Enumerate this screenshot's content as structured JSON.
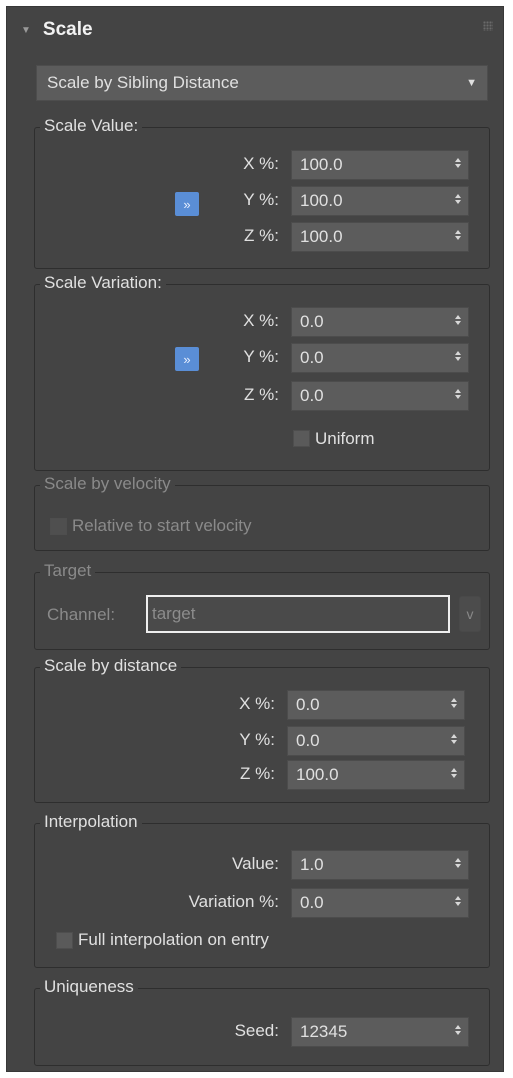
{
  "rollout": {
    "title": "Scale",
    "collapse_icon": "triangle-down-icon",
    "grip_icon": "drag-grip-icon"
  },
  "mode_dropdown": {
    "selected": "Scale by Sibling Distance"
  },
  "scale_value": {
    "title": "Scale Value:",
    "x_label": "X %:",
    "x_value": "100.0",
    "y_label": "Y %:",
    "y_value": "100.0",
    "z_label": "Z %:",
    "z_value": "100.0",
    "link_glyph": "»"
  },
  "scale_variation": {
    "title": "Scale Variation:",
    "x_label": "X %:",
    "x_value": "0.0",
    "y_label": "Y %:",
    "y_value": "0.0",
    "z_label": "Z %:",
    "z_value": "0.0",
    "link_glyph": "»",
    "uniform_label": "Uniform"
  },
  "scale_by_velocity": {
    "title": "Scale by velocity",
    "relative_label": "Relative to start velocity"
  },
  "target": {
    "title": "Target",
    "channel_label": "Channel:",
    "channel_value": "target",
    "channel_button": "v"
  },
  "scale_by_distance": {
    "title": "Scale by distance",
    "x_label": "X %:",
    "x_value": "0.0",
    "y_label": "Y %:",
    "y_value": "0.0",
    "z_label": "Z %:",
    "z_value": "100.0"
  },
  "interpolation": {
    "title": "Interpolation",
    "value_label": "Value:",
    "value": "1.0",
    "variation_label": "Variation %:",
    "variation": "0.0",
    "full_label": "Full interpolation on entry"
  },
  "uniqueness": {
    "title": "Uniqueness",
    "seed_label": "Seed:",
    "seed": "12345"
  },
  "colors": {
    "panel": "#444444",
    "field": "#5c5c5c",
    "accent": "#5a8ed6"
  }
}
